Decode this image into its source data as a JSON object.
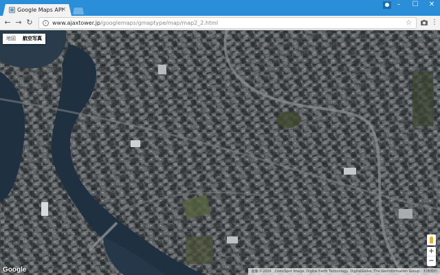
{
  "browser": {
    "tab_title": "Google Maps API サンプル",
    "tab_close": "×",
    "url_domain": "www.ajaxtower.jp",
    "url_path": "/googlemaps/gmaptype/map/map2_2.html",
    "win_minimize": "–",
    "win_maximize": "☐",
    "win_close": "✕",
    "back": "←",
    "forward": "→",
    "reload": "↻",
    "star": "☆",
    "menu": "⋮",
    "info": "i"
  },
  "map": {
    "map_type_options": [
      "地図",
      "航空写真"
    ],
    "selected_map_type": "航空写真",
    "logo": "Google",
    "attribution": "画像 ©2016 , Cnes/Spot Image, Digital Earth Technology, DigitalGlobe, The GeoInformation Group",
    "terms": "利用規約",
    "zoom_in": "+",
    "zoom_out": "−",
    "colors": {
      "water": "#1f3140",
      "city": "#4a4f52"
    }
  }
}
